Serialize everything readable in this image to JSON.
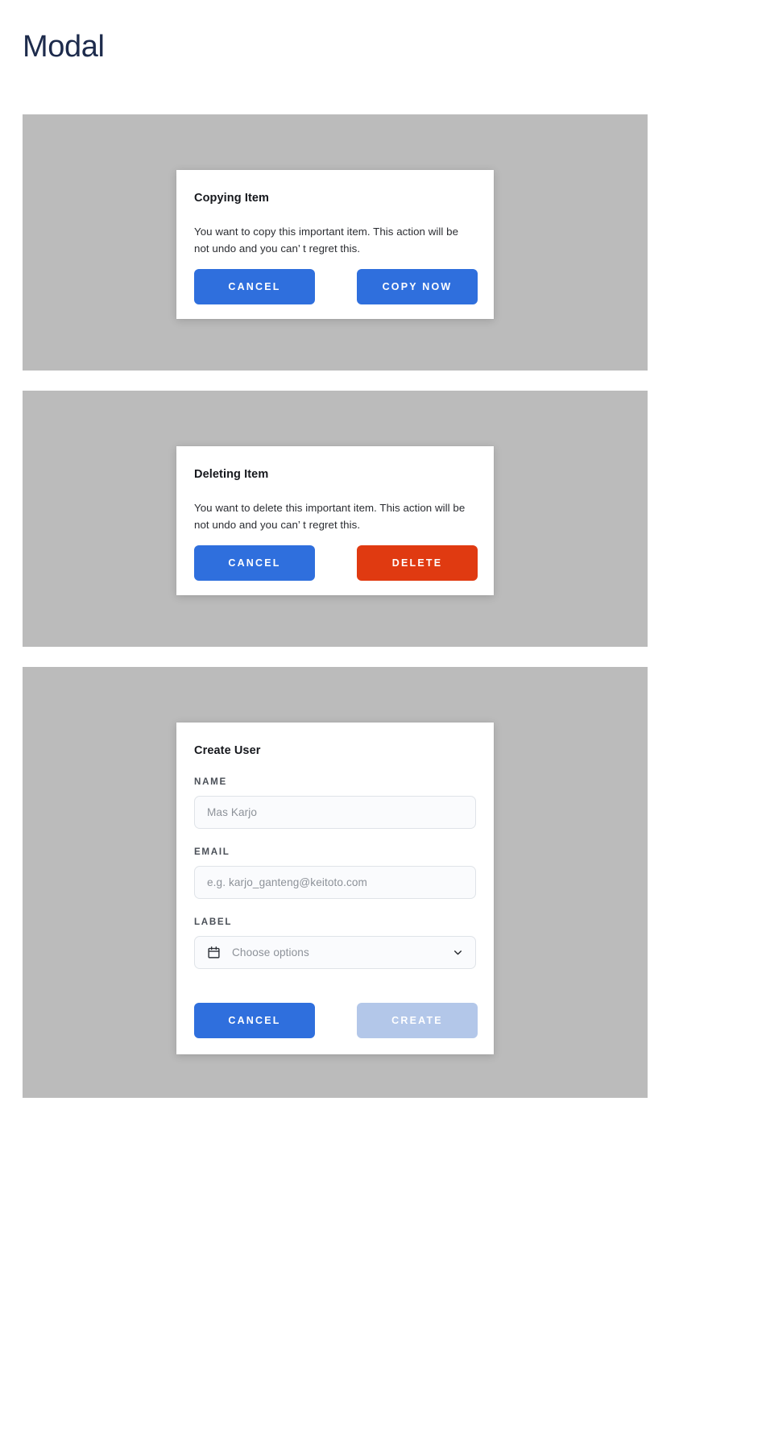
{
  "page": {
    "title": "Modal"
  },
  "modals": [
    {
      "id": "copying-item",
      "title": "Copying Item",
      "body": "You want to copy this important item. This action will be not undo and you can’ t regret this.",
      "buttons": [
        {
          "label": "CANCEL",
          "style": "primary"
        },
        {
          "label": "COPY NOW",
          "style": "primary"
        }
      ]
    },
    {
      "id": "deleting-item",
      "title": "Deleting Item",
      "body": "You want to delete this important item. This action will be not undo and you can’ t regret this.",
      "buttons": [
        {
          "label": "CANCEL",
          "style": "primary"
        },
        {
          "label": "DELETE",
          "style": "danger"
        }
      ]
    },
    {
      "id": "create-user",
      "title": "Create User",
      "fields": [
        {
          "label": "NAME",
          "placeholder": "Mas Karjo",
          "type": "text"
        },
        {
          "label": "EMAIL",
          "placeholder": "e.g. karjo_ganteng@keitoto.com",
          "type": "email"
        },
        {
          "label": "LABEL",
          "placeholder": "Choose options",
          "type": "select",
          "icon": "calendar-icon"
        }
      ],
      "buttons": [
        {
          "label": "CANCEL",
          "style": "primary"
        },
        {
          "label": "CREATE",
          "style": "disabled"
        }
      ]
    }
  ],
  "colors": {
    "title": "#1d2b4c",
    "stage": "#bbbbbb",
    "primary": "#2f6fdd",
    "danger": "#e03a11",
    "disabled": "#b3c7e9",
    "card": "#ffffff",
    "input_bg": "#fafbfd",
    "input_border": "#dfe3e8",
    "placeholder": "#8d9299"
  }
}
